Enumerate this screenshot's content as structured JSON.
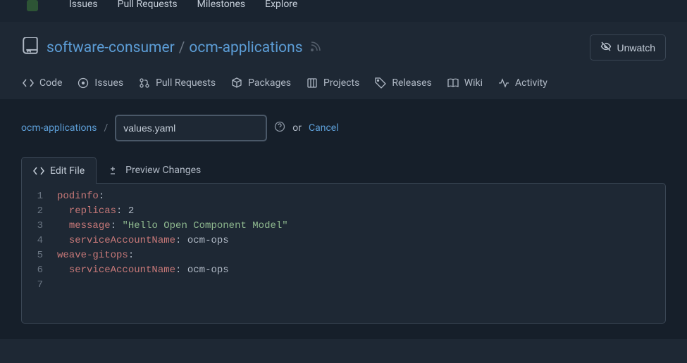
{
  "topNav": {
    "items": [
      "Issues",
      "Pull Requests",
      "Milestones",
      "Explore"
    ]
  },
  "repo": {
    "owner": "software-consumer",
    "separator": "/",
    "name": "ocm-applications",
    "unwatchLabel": "Unwatch"
  },
  "repoTabs": [
    {
      "label": "Code"
    },
    {
      "label": "Issues"
    },
    {
      "label": "Pull Requests"
    },
    {
      "label": "Packages"
    },
    {
      "label": "Projects"
    },
    {
      "label": "Releases"
    },
    {
      "label": "Wiki"
    },
    {
      "label": "Activity"
    }
  ],
  "breadcrumb": {
    "root": "ocm-applications",
    "sep": "/",
    "filename": "values.yaml",
    "or": "or",
    "cancel": "Cancel"
  },
  "editorTabs": {
    "edit": "Edit File",
    "preview": "Preview Changes"
  },
  "code": {
    "lines": [
      {
        "num": "1",
        "parts": [
          {
            "t": "key",
            "v": "podinfo"
          },
          {
            "t": "punct",
            "v": ":"
          }
        ]
      },
      {
        "num": "2",
        "parts": [
          {
            "t": "indent",
            "v": "  "
          },
          {
            "t": "key",
            "v": "replicas"
          },
          {
            "t": "punct",
            "v": ": "
          },
          {
            "t": "value",
            "v": "2"
          }
        ]
      },
      {
        "num": "3",
        "parts": [
          {
            "t": "indent",
            "v": "  "
          },
          {
            "t": "key",
            "v": "message"
          },
          {
            "t": "punct",
            "v": ": "
          },
          {
            "t": "string",
            "v": "\"Hello Open Component Model\""
          }
        ]
      },
      {
        "num": "4",
        "parts": [
          {
            "t": "indent",
            "v": "  "
          },
          {
            "t": "key",
            "v": "serviceAccountName"
          },
          {
            "t": "punct",
            "v": ": "
          },
          {
            "t": "value",
            "v": "ocm-ops"
          }
        ]
      },
      {
        "num": "5",
        "parts": [
          {
            "t": "key",
            "v": "weave-gitops"
          },
          {
            "t": "punct",
            "v": ":"
          }
        ]
      },
      {
        "num": "6",
        "parts": [
          {
            "t": "indent",
            "v": "  "
          },
          {
            "t": "key",
            "v": "serviceAccountName"
          },
          {
            "t": "punct",
            "v": ": "
          },
          {
            "t": "value",
            "v": "ocm-ops"
          }
        ]
      },
      {
        "num": "7",
        "parts": []
      }
    ]
  }
}
